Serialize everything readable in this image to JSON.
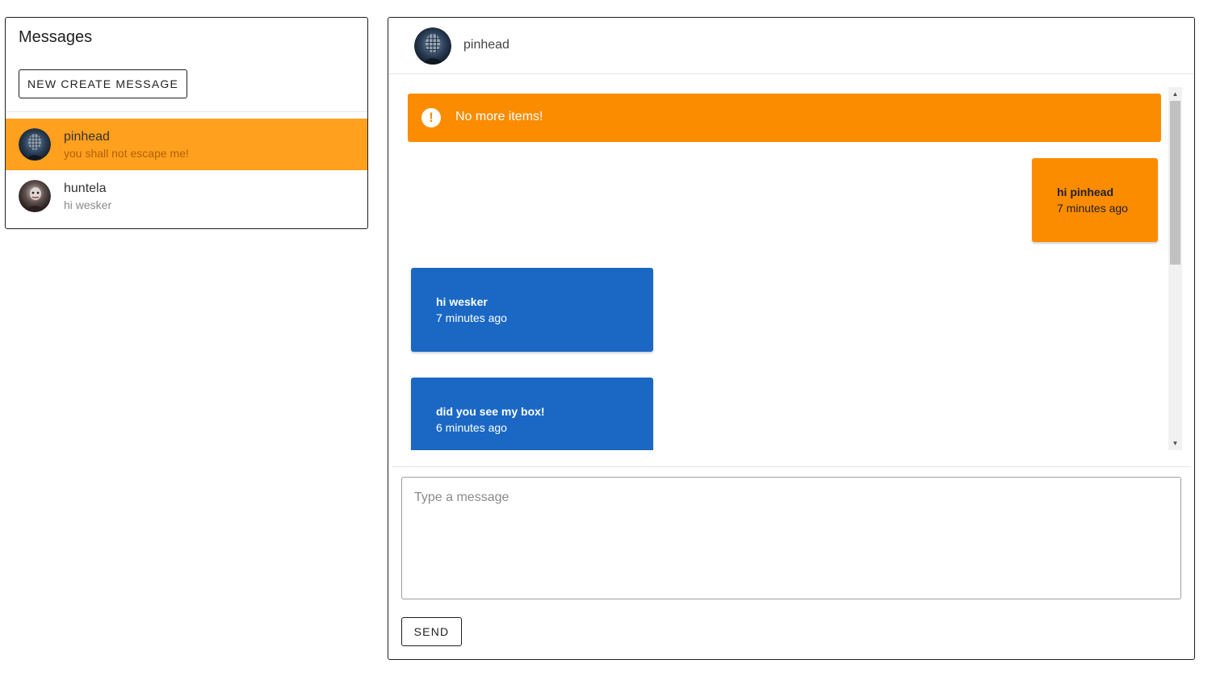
{
  "sidebar": {
    "title": "Messages",
    "new_button_label": "NEW CREATE MESSAGE",
    "conversations": [
      {
        "name": "pinhead",
        "preview": "you shall not escape me!",
        "active": true,
        "avatar": "pinhead-avatar"
      },
      {
        "name": "huntela",
        "preview": "hi wesker",
        "active": false,
        "avatar": "huntela-avatar"
      }
    ]
  },
  "chat": {
    "header_name": "pinhead",
    "header_avatar": "pinhead-avatar",
    "alert": {
      "icon": "alert-circle-icon",
      "text": "No more items!"
    },
    "messages": [
      {
        "text": "hi pinhead",
        "time": "7 minutes ago",
        "from_me": true
      },
      {
        "text": "hi wesker",
        "time": "7 minutes ago",
        "from_me": false
      },
      {
        "text": "did you see my box!",
        "time": "6 minutes ago",
        "from_me": false
      }
    ],
    "input": {
      "placeholder": "Type a message",
      "value": ""
    },
    "send_label": "SEND"
  },
  "colors": {
    "accent_orange": "#fb8c00",
    "active_conversation": "#ffa01e",
    "incoming_bubble": "#1a68c4",
    "border": "#1f1f1f"
  }
}
